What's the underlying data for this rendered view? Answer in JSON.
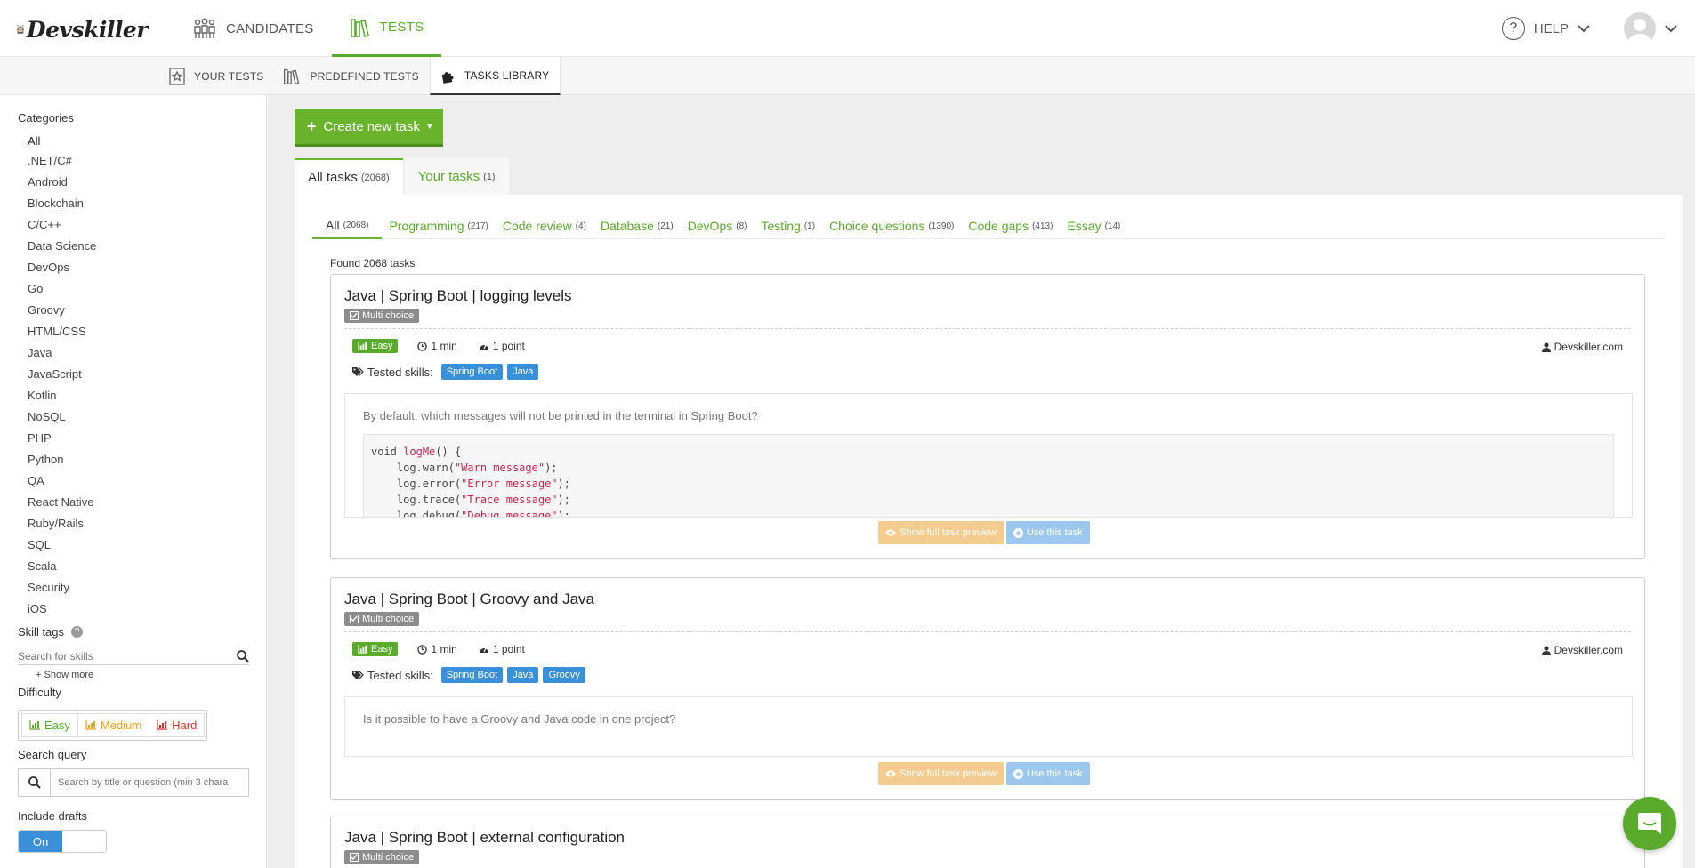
{
  "app": {
    "brand": "Devskiller"
  },
  "topnav": {
    "candidates": "CANDIDATES",
    "tests": "TESTS",
    "help": "HELP"
  },
  "subnav": {
    "your_tests": "YOUR TESTS",
    "predefined_tests": "PREDEFINED TESTS",
    "tasks_library": "TASKS LIBRARY"
  },
  "sidebar": {
    "categories_title": "Categories",
    "categories": [
      "All",
      ".NET/C#",
      "Android",
      "Blockchain",
      "C/C++",
      "Data Science",
      "DevOps",
      "Go",
      "Groovy",
      "HTML/CSS",
      "Java",
      "JavaScript",
      "Kotlin",
      "NoSQL",
      "PHP",
      "Python",
      "QA",
      "React Native",
      "Ruby/Rails",
      "SQL",
      "Scala",
      "Security",
      "iOS"
    ],
    "skill_tags_title": "Skill tags",
    "skill_search_placeholder": "Search for skills",
    "show_more": "Show more",
    "difficulty_title": "Difficulty",
    "difficulty": {
      "easy": "Easy",
      "medium": "Medium",
      "hard": "Hard"
    },
    "search_query_title": "Search query",
    "search_query_placeholder": "Search by title or question (min 3 chara",
    "include_drafts_title": "Include drafts",
    "toggle_on": "On"
  },
  "main": {
    "create_button": "Create new task",
    "tabs": [
      {
        "label": "All tasks",
        "count": "(2068)"
      },
      {
        "label": "Your tasks",
        "count": "(1)"
      }
    ],
    "filters": [
      {
        "label": "All",
        "count": "(2068)"
      },
      {
        "label": "Programming",
        "count": "(217)"
      },
      {
        "label": "Code review",
        "count": "(4)"
      },
      {
        "label": "Database",
        "count": "(21)"
      },
      {
        "label": "DevOps",
        "count": "(8)"
      },
      {
        "label": "Testing",
        "count": "(1)"
      },
      {
        "label": "Choice questions",
        "count": "(1390)"
      },
      {
        "label": "Code gaps",
        "count": "(413)"
      },
      {
        "label": "Essay",
        "count": "(14)"
      }
    ],
    "found": "Found 2068 tasks",
    "tasks": [
      {
        "title": "Java | Spring Boot | logging levels",
        "type": "Multi choice",
        "difficulty": "Easy",
        "time": "1 min",
        "points": "1 point",
        "author": "Devskiller.com",
        "skills_label": "Tested skills:",
        "skills": [
          "Spring Boot",
          "Java"
        ],
        "question": "By default, which messages will not be printed in the terminal in Spring Boot?",
        "code": {
          "kw": "void",
          "fn": "logMe",
          "open": "() {",
          "lines": [
            {
              "pre": "    log.warn(",
              "str": "\"Warn message\"",
              "post": ");"
            },
            {
              "pre": "    log.error(",
              "str": "\"Error message\"",
              "post": ");"
            },
            {
              "pre": "    log.trace(",
              "str": "\"Trace message\"",
              "post": ");"
            },
            {
              "pre": "    log.debug(",
              "str": "\"Debug message\"",
              "post": ");"
            }
          ]
        },
        "preview_button": "Show full task preview",
        "use_button": "Use this task"
      },
      {
        "title": "Java | Spring Boot | Groovy and Java",
        "type": "Multi choice",
        "difficulty": "Easy",
        "time": "1 min",
        "points": "1 point",
        "author": "Devskiller.com",
        "skills_label": "Tested skills:",
        "skills": [
          "Spring Boot",
          "Java",
          "Groovy"
        ],
        "question": "Is it possible to have a Groovy and Java code in one project?",
        "preview_button": "Show full task preview",
        "use_button": "Use this task"
      },
      {
        "title": "Java | Spring Boot | external configuration",
        "type": "Multi choice"
      }
    ]
  },
  "colors": {
    "accent": "#5aab2c",
    "blue": "#3a8fd9",
    "orange": "#f0a11a",
    "red": "#d9342b"
  }
}
